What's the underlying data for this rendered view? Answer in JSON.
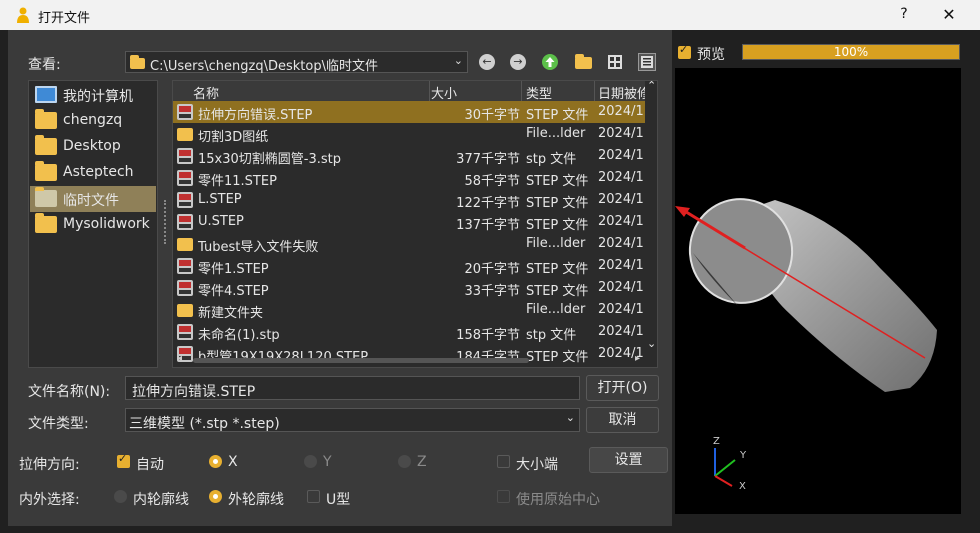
{
  "window": {
    "title": "打开文件",
    "help": "?",
    "close": "✕"
  },
  "lookin": {
    "label": "查看:",
    "path": "C:\\Users\\chengzq\\Desktop\\临时文件"
  },
  "preview": {
    "label": "预览",
    "checked": true,
    "progress": 100,
    "progress_text": "100%"
  },
  "sidebar": {
    "items": [
      {
        "label": "我的计算机",
        "icon": "computer-icon",
        "selected": false
      },
      {
        "label": "chengzq",
        "icon": "folder-icon",
        "selected": false
      },
      {
        "label": "Desktop",
        "icon": "folder-icon",
        "selected": false
      },
      {
        "label": "Asteptech",
        "icon": "folder-icon",
        "selected": false
      },
      {
        "label": "临时文件",
        "icon": "folder-icon",
        "selected": true
      },
      {
        "label": "Mysolidwork",
        "icon": "folder-icon",
        "selected": false
      }
    ]
  },
  "files": {
    "columns": [
      "名称",
      "大小",
      "类型",
      "日期被修"
    ],
    "rows": [
      {
        "name": "拉伸方向错误.STEP",
        "size": "30千字节",
        "type": "STEP 文件",
        "date": "2024/1",
        "icon": "step-file-icon",
        "selected": true
      },
      {
        "name": "切割3D图纸",
        "size": "",
        "type": "File...lder",
        "date": "2024/1",
        "icon": "folder-icon",
        "selected": false
      },
      {
        "name": "15x30切割椭圆管-3.stp",
        "size": "377千字节",
        "type": "stp 文件",
        "date": "2024/1",
        "icon": "step-file-icon",
        "selected": false
      },
      {
        "name": "零件11.STEP",
        "size": "58千字节",
        "type": "STEP 文件",
        "date": "2024/1",
        "icon": "step-file-icon",
        "selected": false
      },
      {
        "name": "L.STEP",
        "size": "122千字节",
        "type": "STEP 文件",
        "date": "2024/1",
        "icon": "step-file-icon",
        "selected": false
      },
      {
        "name": "U.STEP",
        "size": "137千字节",
        "type": "STEP 文件",
        "date": "2024/1",
        "icon": "step-file-icon",
        "selected": false
      },
      {
        "name": "Tubest导入文件失败",
        "size": "",
        "type": "File...lder",
        "date": "2024/1",
        "icon": "folder-icon",
        "selected": false
      },
      {
        "name": "零件1.STEP",
        "size": "20千字节",
        "type": "STEP 文件",
        "date": "2024/1",
        "icon": "step-file-icon",
        "selected": false
      },
      {
        "name": "零件4.STEP",
        "size": "33千字节",
        "type": "STEP 文件",
        "date": "2024/1",
        "icon": "step-file-icon",
        "selected": false
      },
      {
        "name": "新建文件夹",
        "size": "",
        "type": "File...lder",
        "date": "2024/1",
        "icon": "folder-icon",
        "selected": false
      },
      {
        "name": "未命名(1).stp",
        "size": "158千字节",
        "type": "stp 文件",
        "date": "2024/1",
        "icon": "step-file-icon",
        "selected": false
      },
      {
        "name": "b型管19X19X28L120.STEP",
        "size": "184千字节",
        "type": "STEP 文件",
        "date": "2024/1",
        "icon": "step-file-icon",
        "selected": false
      }
    ]
  },
  "filename": {
    "label": "文件名称(N):",
    "value": "拉伸方向错误.STEP",
    "open": "打开(O)"
  },
  "filetype": {
    "label": "文件类型:",
    "value": "三维模型 (*.stp *.step)",
    "cancel": "取消"
  },
  "extrude": {
    "label": "拉伸方向:",
    "auto": "自动",
    "auto_checked": true,
    "x": "X",
    "y": "Y",
    "z": "Z",
    "selected": "X",
    "endian": "大小端",
    "endian_checked": false,
    "settings": "设置"
  },
  "contour": {
    "label": "内外选择:",
    "inner": "内轮廓线",
    "outer": "外轮廓线",
    "selected": "外轮廓线",
    "utype": "U型",
    "utype_checked": false,
    "origin_center": "使用原始中心",
    "origin_center_enabled": false
  },
  "axes": {
    "z": "Z",
    "y": "Y",
    "x": "X"
  }
}
